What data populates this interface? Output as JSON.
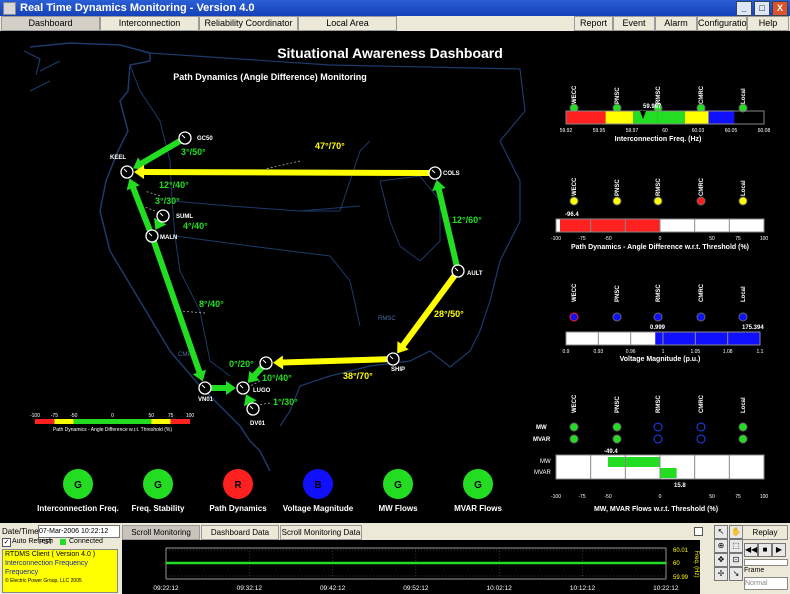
{
  "window": {
    "title": "Real Time Dynamics Monitoring - Version 4.0",
    "buttons": [
      "_",
      "□",
      "X"
    ]
  },
  "menu": {
    "left": [
      {
        "label": "Dashboard",
        "w": 97,
        "active": true
      },
      {
        "label": "Interconnection",
        "w": 97
      },
      {
        "label": "Reliability Coordinator",
        "w": 97
      },
      {
        "label": "Local Area",
        "w": 97
      }
    ],
    "right": [
      {
        "label": "Report",
        "w": 37
      },
      {
        "label": "Event Files",
        "w": 40
      },
      {
        "label": "Alarm Logs",
        "w": 40
      },
      {
        "label": "Configuration",
        "w": 48
      },
      {
        "label": "Help",
        "w": 40
      }
    ]
  },
  "dashboard": {
    "title": "Situational Awareness Dashboard",
    "subtitle": "Path Dynamics (Angle Difference) Monitoring",
    "map_regions": [
      "RMSC",
      "CMP"
    ],
    "nodes": [
      {
        "id": "GC50",
        "label": "GC50"
      },
      {
        "id": "KEEL",
        "label": "KEEL"
      },
      {
        "id": "SUML",
        "label": "SUML"
      },
      {
        "id": "MALN",
        "label": "MALN"
      },
      {
        "id": "COLS",
        "label": "COLS"
      },
      {
        "id": "AULT",
        "label": "AULT"
      },
      {
        "id": "SHIP",
        "label": "SHIP"
      },
      {
        "id": "VN01",
        "label": "VN01"
      },
      {
        "id": "LUGO",
        "label": "LUGO"
      },
      {
        "id": "DV01",
        "label": "DV01"
      },
      {
        "id": "LUGO2",
        "label": ""
      }
    ],
    "paths": [
      {
        "from": "GC50",
        "to": "KEEL",
        "label": "3°/50°",
        "color": "#22dd22"
      },
      {
        "from": "COLS",
        "to": "KEEL",
        "label": "47°/70°",
        "color": "#ffff00"
      },
      {
        "from": "MALN",
        "to": "KEEL",
        "label": "12°/40°",
        "color": "#22dd22"
      },
      {
        "from": "SUML",
        "to": "MALN",
        "label": "4°/40°",
        "color": "#22dd22"
      },
      {
        "from": "AULT",
        "to": "COLS",
        "label": "12°/60°",
        "color": "#22dd22"
      },
      {
        "from": "AULT",
        "to": "SHIP",
        "label": "28°/50°",
        "color": "#ffff00"
      },
      {
        "from": "SHIP",
        "to": "LUGO2",
        "label": "38°/70°",
        "color": "#ffff00"
      },
      {
        "from": "MALN",
        "to": "VN01",
        "label": "8°/40°",
        "color": "#22dd22"
      },
      {
        "from": "VN01",
        "to": "LUGO",
        "label": "0°/20°",
        "color": "#22dd22"
      },
      {
        "from": "LUGO2",
        "to": "LUGO",
        "label": "10°/40°",
        "color": "#22dd22"
      },
      {
        "from": "DV01",
        "to": "LUGO",
        "label": "1°/30°",
        "color": "#22dd22"
      }
    ],
    "extra_labels": [
      {
        "text": "3°/30°"
      }
    ],
    "map_scale": {
      "ticks": [
        "-100",
        "-75",
        "-50",
        "0",
        "50",
        "75",
        "100"
      ],
      "caption": "Path Dynamics - Angle Difference w.r.t. Threshold (%)"
    },
    "status": [
      {
        "letter": "G",
        "label": "Interconnection Freq.",
        "color": "#22dd22"
      },
      {
        "letter": "G",
        "label": "Freq. Stability",
        "color": "#22dd22"
      },
      {
        "letter": "R",
        "label": "Path Dynamics",
        "color": "#ff2020"
      },
      {
        "letter": "B",
        "label": "Voltage Magnitude",
        "color": "#1010ff"
      },
      {
        "letter": "G",
        "label": "MW Flows",
        "color": "#22dd22"
      },
      {
        "letter": "G",
        "label": "MVAR Flows",
        "color": "#22dd22"
      }
    ],
    "regions": [
      "WECC",
      "PNSC",
      "RMSC",
      "CMRC",
      "Local"
    ],
    "freq_panel": {
      "value": "59.987",
      "dots": [
        "#22dd22",
        "#22dd22",
        "#22dd22",
        "#22dd22",
        "#22dd22"
      ],
      "ticks": [
        "59.92",
        "59.95",
        "59.97",
        "60",
        "60.03",
        "60.05",
        "60.08"
      ],
      "caption": "Interconnection Freq. (Hz)"
    },
    "angle_panel": {
      "value": "-96.4",
      "dots": [
        "#ffff00",
        "#ffff00",
        "#ffff00",
        "#ff2020",
        "#ffff00"
      ],
      "ticks": [
        "-100",
        "-75",
        "-50",
        "0",
        "50",
        "75",
        "100"
      ],
      "caption": "Path Dynamics - Angle Difference w.r.t. Threshold (%)"
    },
    "voltage_panel": {
      "min_value": "0.999",
      "max_value": "175.394",
      "dots": [
        "#1010ff",
        "#1010ff",
        "#1010ff",
        "#1010ff",
        "#1010ff"
      ],
      "ticks": [
        "0.9",
        "0.93",
        "0.96",
        "1",
        "1.05",
        "1.08",
        "1.1"
      ],
      "caption": "Voltage Magnitude (p.u.)"
    },
    "flow_panel": {
      "rows": [
        "MW",
        "MVAR"
      ],
      "dots_mw": [
        "#22dd22",
        "#22dd22",
        "#000044",
        "#000044",
        "#22dd22"
      ],
      "dots_mvar": [
        "#22dd22",
        "#22dd22",
        "#000044",
        "#000044",
        "#22dd22"
      ],
      "mw_value": "-49.4",
      "mvar_value": "15.8",
      "ticks": [
        "-100",
        "-75",
        "-50",
        "0",
        "50",
        "75",
        "100"
      ],
      "caption": "MW, MVAR Flows w.r.t. Threshold (%)"
    }
  },
  "bottom": {
    "datetime_label": "Date/Time:",
    "datetime_value": "07-Mar-2006 10:22:12 PST",
    "auto_refresh": "Auto Refresh",
    "connected": "Connected",
    "client": "RTDMS Client ( Version 4.0 )",
    "info1": "Interconnection Frequency",
    "info2": "Frequency",
    "copyright": "© Electric Power Group, LLC 2005",
    "tabs": [
      "Scroll Monitoring",
      "Dashboard Data",
      "Scroll Monitoring Data"
    ],
    "ylabels": [
      "60.01",
      "60",
      "59.99"
    ],
    "yaxis": "Freq. (Hz)",
    "times": [
      "09:22:12",
      "09:32:12",
      "09:42:12",
      "09:52:12",
      "10:02:12",
      "10:12:12",
      "10:22:12"
    ],
    "replay": "Replay",
    "frame_label": "Frame",
    "frame_value": "Normal"
  }
}
